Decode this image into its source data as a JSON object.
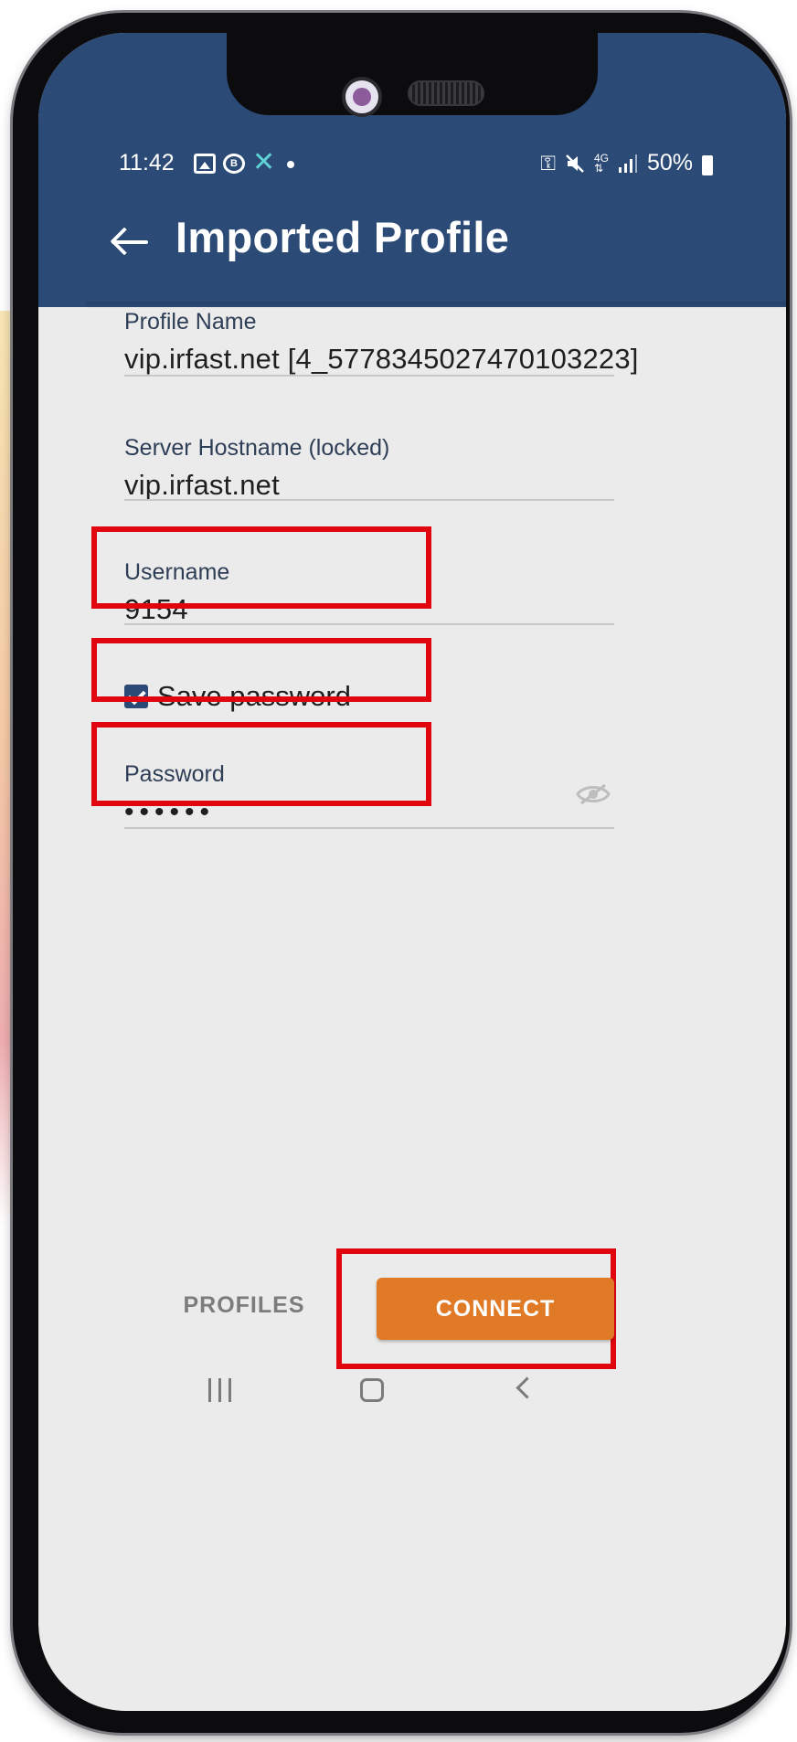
{
  "status_bar": {
    "time": "11:42",
    "battery": "50%",
    "icons": [
      "gallery-icon",
      "b-badge-icon",
      "x-icon",
      "dot-icon",
      "vpn-key-icon",
      "mute-icon",
      "4g-icon",
      "signal-icon",
      "battery-icon"
    ]
  },
  "app_bar": {
    "title": "Imported Profile",
    "back_icon": "back-arrow-icon"
  },
  "form": {
    "profile_name": {
      "label": "Profile Name",
      "value": "vip.irfast.net [4_5778345027470103223]"
    },
    "server_hostname": {
      "label": "Server Hostname (locked)",
      "value": "vip.irfast.net"
    },
    "username": {
      "label": "Username",
      "value": "9154"
    },
    "save_password": {
      "label": "Save password",
      "checked": true
    },
    "password": {
      "label": "Password",
      "value": "••••••",
      "toggle_icon": "eye-off-icon"
    }
  },
  "actions": {
    "profiles_label": "PROFILES",
    "connect_label": "CONNECT"
  },
  "colors": {
    "header": "#2b4a76",
    "connect": "#e07a26",
    "highlight": "#e0050f"
  }
}
